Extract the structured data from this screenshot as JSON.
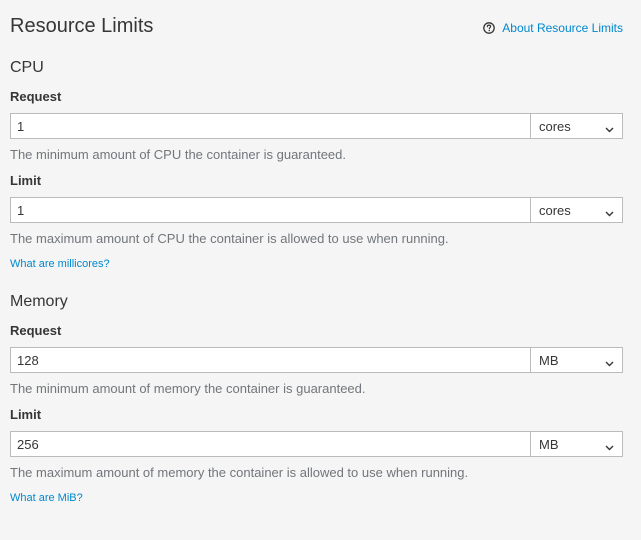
{
  "header": {
    "title": "Resource Limits",
    "about_link": "About Resource Limits",
    "about_icon": "question-circle-icon"
  },
  "cpu": {
    "title": "CPU",
    "request": {
      "label": "Request",
      "value": "1",
      "unit": "cores",
      "help": "The minimum amount of CPU the container is guaranteed."
    },
    "limit": {
      "label": "Limit",
      "value": "1",
      "unit": "cores",
      "help": "The maximum amount of CPU the container is allowed to use when running."
    },
    "info_link": "What are millicores?"
  },
  "memory": {
    "title": "Memory",
    "request": {
      "label": "Request",
      "value": "128",
      "unit": "MB",
      "help": "The minimum amount of memory the container is guaranteed."
    },
    "limit": {
      "label": "Limit",
      "value": "256",
      "unit": "MB",
      "help": "The maximum amount of memory the container is allowed to use when running."
    },
    "info_link": "What are MiB?"
  },
  "colors": {
    "background": "#f5f5f5",
    "link": "#0088ce",
    "text": "#363636",
    "muted_text": "#72767b",
    "border": "#bbbbbb"
  }
}
